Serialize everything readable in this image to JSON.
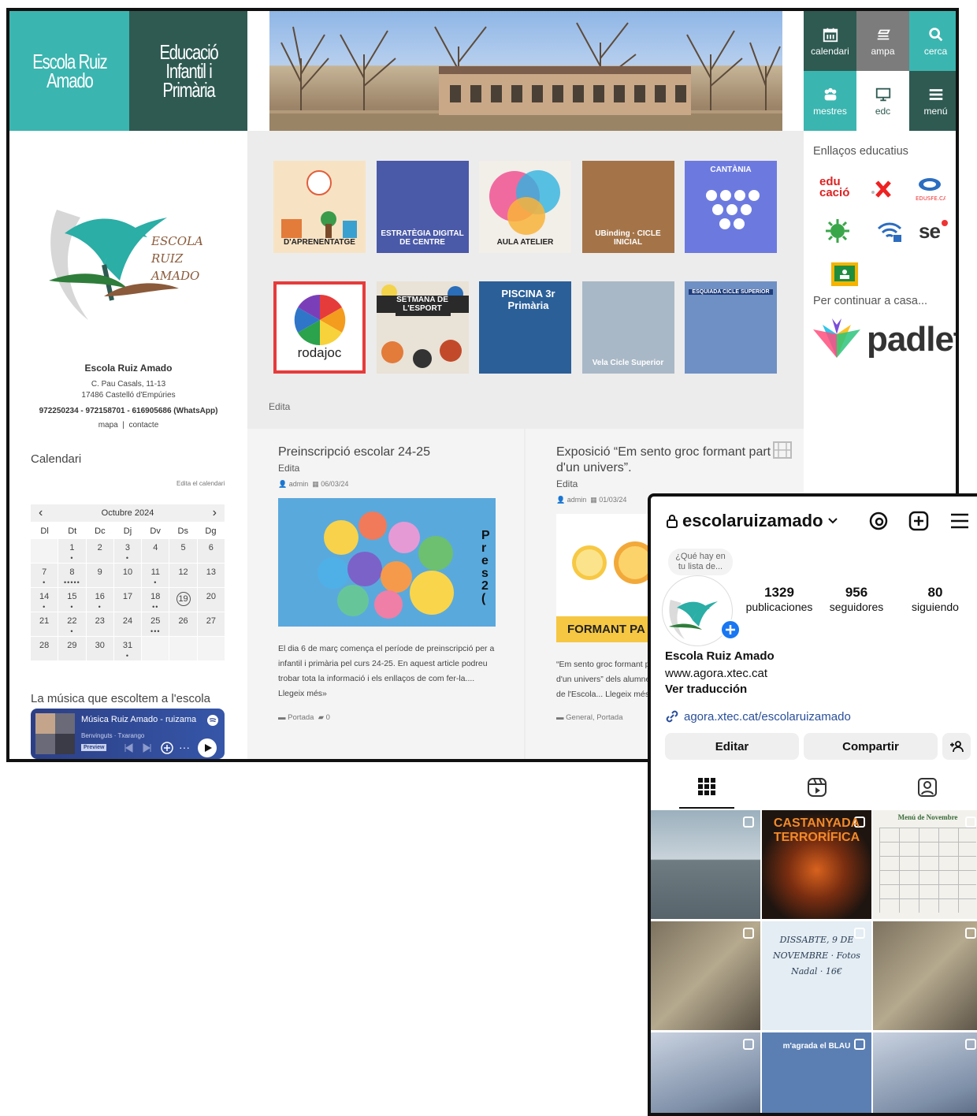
{
  "site": {
    "logo_name": "Escola Ruiz\nAmado",
    "logo_subtitle": "Educació\nInfantil i\nPrimària",
    "nav": [
      {
        "label": "calendari",
        "icon": "calendar-icon"
      },
      {
        "label": "ampa",
        "icon": "books-icon"
      },
      {
        "label": "cerca",
        "icon": "search-icon"
      },
      {
        "label": "mestres",
        "icon": "people-icon"
      },
      {
        "label": "edc",
        "icon": "monitor-icon"
      },
      {
        "label": "menú",
        "icon": "hamburger-icon"
      }
    ],
    "colors": {
      "teal": "#3bb5b0",
      "dark_green": "#2e5a52",
      "grey": "#7c7c7c"
    },
    "school": {
      "logo_text": [
        "ESCOLA",
        "RUIZ",
        "AMADO"
      ],
      "name": "Escola Ruiz Amado",
      "address1": "C. Pau Casals, 11-13",
      "address2": "17486 Castelló d'Empúries",
      "phones": "972250234 - 972158701 - 616905686 (WhatsApp)",
      "link_map": "mapa",
      "separator": "|",
      "link_contact": "contacte"
    },
    "calendar": {
      "title": "Calendari",
      "edit_link": "Edita el calendari",
      "prev": "‹",
      "next": "›",
      "month": "Octubre 2024",
      "weekdays": [
        "Dl",
        "Dt",
        "Dc",
        "Dj",
        "Dv",
        "Ds",
        "Dg"
      ],
      "leading_blanks": 1,
      "days": 31,
      "today": 19,
      "events": {
        "1": "•",
        "3": "•",
        "7": "•",
        "8": "•••••",
        "11": "•",
        "14": "•",
        "15": "•",
        "16": "•",
        "18": "••",
        "22": "•",
        "25": "•••",
        "31": "•"
      }
    },
    "music": {
      "title": "La música que escoltem a l'escola",
      "player_title": "Música Ruiz Amado - ruizama",
      "player_subtitle": "Benvinguts · Txarango",
      "preview": "Preview",
      "more": "···"
    },
    "gallery": {
      "tiles": [
        {
          "label": "D'APRENENTATGE",
          "bg": "#f7e3c4"
        },
        {
          "label": "ESTRATÈGIA DIGITAL DE CENTRE",
          "bg": "#4a59a8"
        },
        {
          "label": "AULA ATELIER",
          "bg": "#f2eee8"
        },
        {
          "label": "UBinding · CICLE INICIAL",
          "bg": "#a47448"
        },
        {
          "label": "CANTÀNIA",
          "bg": "#6c7ae0"
        },
        {
          "label": "rodajoc",
          "bg": "#ffffff"
        },
        {
          "label": "SETMANA DE L'ESPORT",
          "bg": "#e9e2d6"
        },
        {
          "label": "PISCINA 3r Primària",
          "bg": "#2b5f98"
        },
        {
          "label": "Vela Cicle Superior",
          "bg": "#a9b8c6"
        },
        {
          "label": "ESQUIADA CICLE SUPERIOR",
          "bg": "#6f90c4"
        }
      ],
      "edit": "Edita"
    },
    "posts": [
      {
        "title": "Preinscripció escolar 24-25",
        "edit": "Edita",
        "author": "admin",
        "date": "06/03/24",
        "text": "El dia 6 de març comença el període de preinscripció per a infantil i primària pel curs 24-25. En aquest article podreu trobar tota la informació i els enllaços de com fer-la.... Llegeix més»",
        "category": "Portada",
        "comments": "0",
        "banner_text": "Pr es 2("
      },
      {
        "title": "Exposició “Em sento groc formant part d'un univers”.",
        "edit": "Edita",
        "author": "admin",
        "date": "01/03/24",
        "text": "“Em sento groc formant part d'un univers” dels alumnes de l'Escola... Llegeix més»",
        "category": "General, Portada",
        "banner_text": "FORMANT PA"
      }
    ],
    "right": {
      "links_title": "Enllaços educatius",
      "link_edu": "edu\ncació",
      "link_edusfe": "EDUSFE.CAT",
      "link_se": "se",
      "continue_title": "Per continuar a casa...",
      "padlet": "padlet"
    }
  },
  "instagram": {
    "username": "escolaruizamado",
    "note": "¿Qué hay en tu lista de...",
    "stats": [
      {
        "num": "1329",
        "label": "publicaciones"
      },
      {
        "num": "956",
        "label": "seguidores"
      },
      {
        "num": "80",
        "label": "siguiendo"
      }
    ],
    "name": "Escola Ruiz Amado",
    "website": "www.agora.xtec.cat",
    "translate": "Ver traducción",
    "link": "agora.xtec.cat/escolaruizamado",
    "btn_edit": "Editar",
    "btn_share": "Compartir",
    "posts": [
      {
        "bg": "#8ea2ad",
        "text": ""
      },
      {
        "bg": "#2e1f16",
        "text": "CASTANYADA TERRORÍFICA"
      },
      {
        "bg": "#f2f1ec",
        "text": "Menú de Novembre"
      },
      {
        "bg": "#6d6454",
        "text": ""
      },
      {
        "bg": "#e3edf3",
        "text": "DISSABTE, 9 DE NOVEMBRE · Fotos Nadal · 16€"
      },
      {
        "bg": "#8b806d",
        "text": ""
      },
      {
        "bg": "#a7b4c6",
        "text": ""
      },
      {
        "bg": "#5b7fb3",
        "text": "m'agrada el BLAU"
      },
      {
        "bg": "#9c9ea8",
        "text": ""
      }
    ]
  }
}
